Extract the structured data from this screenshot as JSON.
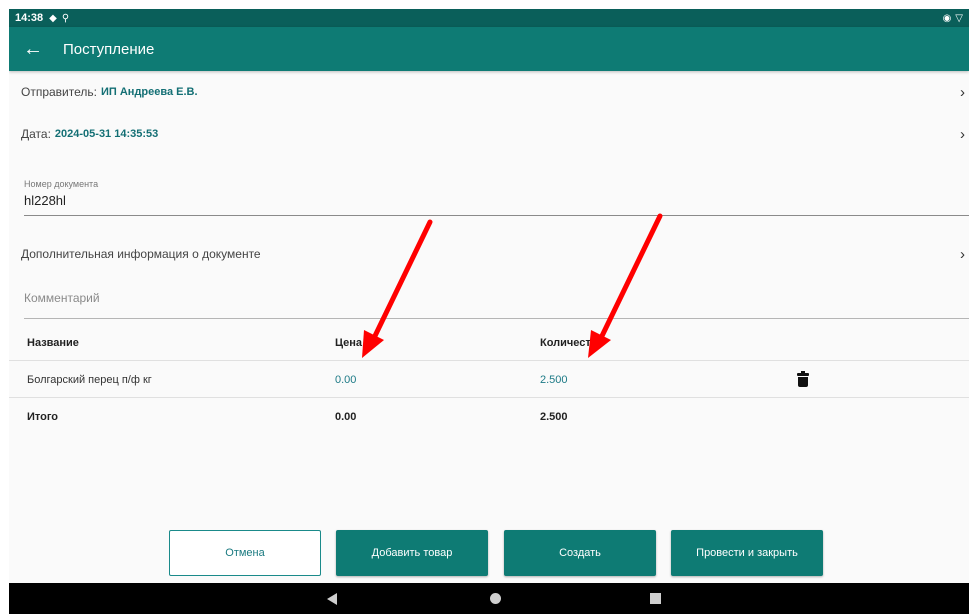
{
  "status_bar": {
    "time": "14:38"
  },
  "toolbar": {
    "title": "Поступление"
  },
  "sender": {
    "label": "Отправитель:",
    "value": "ИП Андреева Е.В."
  },
  "date": {
    "label": "Дата:",
    "value": "2024-05-31 14:35:53"
  },
  "doc_number": {
    "label": "Номер документа",
    "value": "hl228hl"
  },
  "extra_info": {
    "label": "Дополнительная информация о документе"
  },
  "comment": {
    "placeholder": "Комментарий"
  },
  "table": {
    "headers": {
      "name": "Название",
      "price": "Цена",
      "quantity": "Количест"
    },
    "rows": [
      {
        "name": "Болгарский перец п/ф кг",
        "price": "0.00",
        "quantity": "2.500"
      }
    ],
    "total": {
      "label": "Итого",
      "price": "0.00",
      "quantity": "2.500"
    }
  },
  "buttons": {
    "cancel": "Отмена",
    "add_item": "Добавить товар",
    "create": "Создать",
    "post_and_close": "Провести и закрыть"
  },
  "colors": {
    "primary": "#0e7b74",
    "status_bar": "#0a5f5a",
    "accent_text": "#136f74",
    "annotation_arrow": "#ff0000"
  }
}
